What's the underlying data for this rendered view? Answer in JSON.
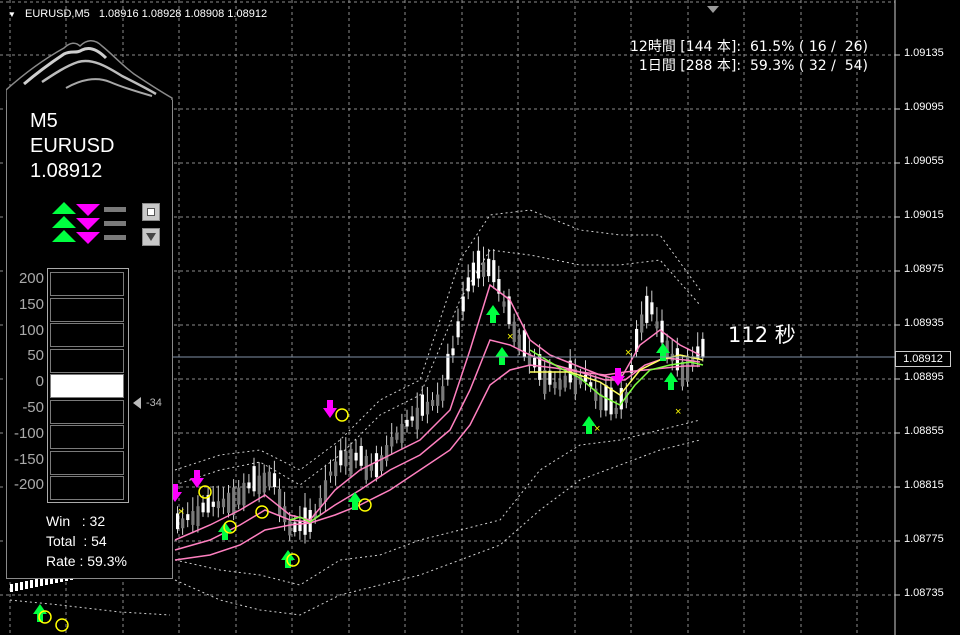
{
  "header": {
    "symbol_tf": "EURUSD,M5",
    "ohlc": "1.08916 1.08928 1.08908 1.08912"
  },
  "stats": {
    "line1": "12時間 [144 本]:  61.5% ( 16 /  26)",
    "line2": "1日間 [288 本]:  59.3% ( 32 /  54)"
  },
  "price_axis": [
    "1.09135",
    "1.09095",
    "1.09055",
    "1.09015",
    "1.08975",
    "1.08935",
    "1.08895",
    "1.08855",
    "1.08815",
    "1.08775",
    "1.08735"
  ],
  "current_price": "1.08912",
  "countdown": "112 秒",
  "panel": {
    "timeframe": "M5",
    "symbol": "EURUSD",
    "price": "1.08912",
    "gauge_labels": [
      "200",
      "150",
      "100",
      "50",
      "0",
      "-50",
      "-100",
      "-150",
      "-200"
    ],
    "gauge_readout": "-34",
    "win_line": "Win   : 32",
    "total_line": "Total  : 54",
    "rate_line": "Rate : 59.3%"
  },
  "colors": {
    "bg": "#000000",
    "grid": "#8c8c8c",
    "bull_candle": "#ffffff",
    "bear_candle": "#7a7a7a",
    "ma_pink": "#ff80c0",
    "ma_green": "#80ff40",
    "ma_yellow": "#ffff60",
    "arrow_up": "#00ff40",
    "arrow_down": "#ff00ff",
    "circle": "#ffff00"
  }
}
